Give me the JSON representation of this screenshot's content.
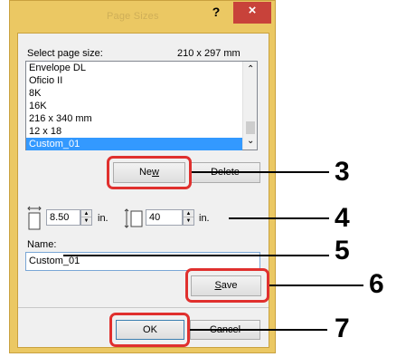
{
  "window": {
    "title": "Page Sizes",
    "help_label": "?",
    "close_label": "×"
  },
  "page_size": {
    "label": "Select page size:",
    "current_size": "210 x 297 mm",
    "items": [
      "Envelope DL",
      "Oficio II",
      "8K",
      "16K",
      "216 x 340 mm",
      "12 x 18",
      "Custom_01"
    ],
    "selected": "Custom_01"
  },
  "buttons": {
    "new_prefix": "Ne",
    "new_access": "w",
    "delete_label": "Delete",
    "save_prefix": "",
    "save_access": "S",
    "save_suffix": "ave",
    "ok_label": "OK",
    "cancel_label": "Cancel"
  },
  "dimensions": {
    "width_value": "8.50",
    "width_unit": "in.",
    "height_value": "40",
    "height_unit": "in."
  },
  "name": {
    "label": "Name:",
    "value": "Custom_01"
  },
  "callouts": [
    "3",
    "4",
    "5",
    "6",
    "7"
  ]
}
